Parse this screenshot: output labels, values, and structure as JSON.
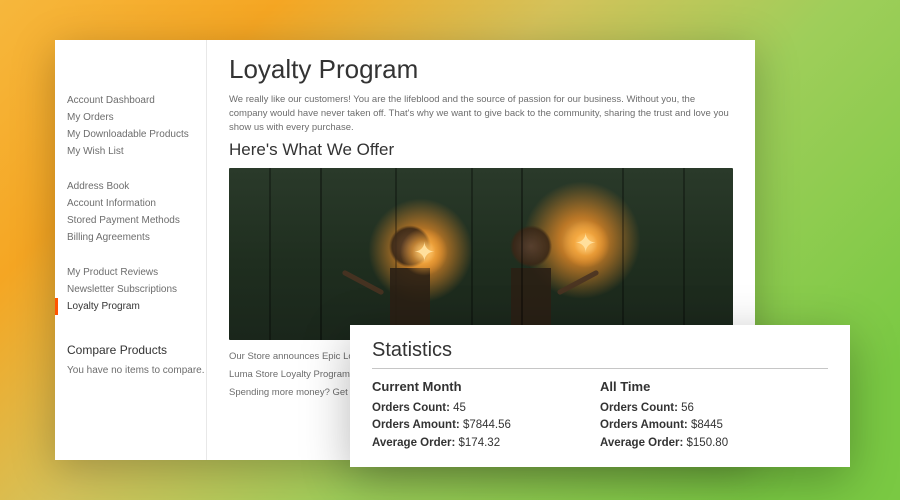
{
  "sidebar": {
    "group1": [
      {
        "label": "Account Dashboard"
      },
      {
        "label": "My Orders"
      },
      {
        "label": "My Downloadable Products"
      },
      {
        "label": "My Wish List"
      }
    ],
    "group2": [
      {
        "label": "Address Book"
      },
      {
        "label": "Account Information"
      },
      {
        "label": "Stored Payment Methods"
      },
      {
        "label": "Billing Agreements"
      }
    ],
    "group3": [
      {
        "label": "My Product Reviews"
      },
      {
        "label": "Newsletter Subscriptions"
      },
      {
        "label": "Loyalty Program"
      }
    ],
    "compare_heading": "Compare Products",
    "compare_text": "You have no items to compare."
  },
  "content": {
    "title": "Loyalty Program",
    "intro": "We really like our customers! You are the lifeblood and the source of passion for our business. Without you, the company would have never taken off. That's why we want to give back to the community, sharing the trust and love you show us with every purchase.",
    "offer_heading": "Here's What We Offer",
    "desc1": "Our Store announces Epic Loyalty Program de",
    "desc2": "Luma Store Loyalty Program caters to all type that you get progressively better deals – cons",
    "desc3": "Spending more money? Get a bonus. Got ove you make a purchase, we try to give back and"
  },
  "stats": {
    "heading": "Statistics",
    "current": {
      "title": "Current Month",
      "orders_count_label": "Orders Count:",
      "orders_count": "45",
      "orders_amount_label": "Orders Amount:",
      "orders_amount": "$7844.56",
      "avg_label": "Average Order:",
      "avg": "$174.32"
    },
    "alltime": {
      "title": "All Time",
      "orders_count_label": "Orders Count:",
      "orders_count": "56",
      "orders_amount_label": "Orders Amount:",
      "orders_amount": "$8445",
      "avg_label": "Average Order:",
      "avg": "$150.80"
    }
  }
}
